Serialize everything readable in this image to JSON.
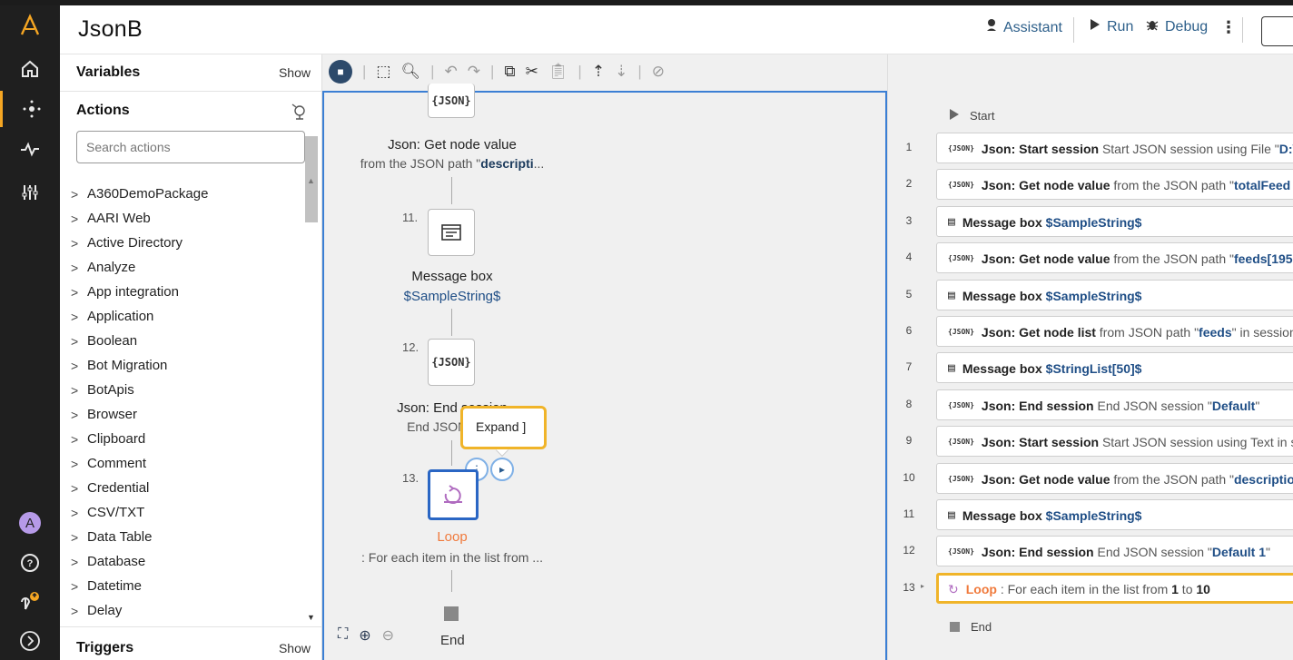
{
  "header": {
    "title": "JsonB",
    "assistant_label": "Assistant",
    "run_label": "Run",
    "debug_label": "Debug"
  },
  "rail": {
    "icons": [
      "logo-icon",
      "home-icon",
      "bots-icon",
      "activity-icon",
      "settings-icon",
      "avatar",
      "help-icon",
      "location-icon",
      "expand-icon"
    ],
    "avatar_letter": "A"
  },
  "left_panel": {
    "variables_label": "Variables",
    "variables_show": "Show",
    "actions_label": "Actions",
    "search_placeholder": "Search actions",
    "actions": [
      "A360DemoPackage",
      "AARI Web",
      "Active Directory",
      "Analyze",
      "App integration",
      "Application",
      "Boolean",
      "Bot Migration",
      "BotApis",
      "Browser",
      "Clipboard",
      "Comment",
      "Credential",
      "CSV/TXT",
      "Data Table",
      "Database",
      "Datetime",
      "Delay"
    ],
    "triggers_label": "Triggers",
    "triggers_show": "Show"
  },
  "flow": {
    "node10": {
      "icon_text": "{JSON}",
      "title": "Json: Get node value",
      "sub_prefix": "from the JSON path \"",
      "sub_value": "descripti",
      "sub_suffix": "..."
    },
    "node11": {
      "num": "11.",
      "title": "Message box",
      "sub": "$SampleString$"
    },
    "node12": {
      "num": "12.",
      "icon_text": "{JSON}",
      "title": "Json: End session",
      "sub": "End JSON sessi"
    },
    "tooltip": "Expand ]",
    "node13": {
      "num": "13.",
      "title": "Loop",
      "sub": ": For each item in the list from ..."
    },
    "end_label": "End"
  },
  "list": {
    "start_label": "Start",
    "rows": [
      {
        "n": "1",
        "icon": "json",
        "name": "Json: Start session",
        "text": " Start JSON session using File \"",
        "val": "D:\\A"
      },
      {
        "n": "2",
        "icon": "json",
        "name": "Json: Get node value",
        "text": " from the JSON path \"",
        "val": "totalFeed"
      },
      {
        "n": "3",
        "icon": "msg",
        "name": "Message box",
        "text": " ",
        "val": "$SampleString$"
      },
      {
        "n": "4",
        "icon": "json",
        "name": "Json: Get node value",
        "text": " from the JSON path \"",
        "val": "feeds[195"
      },
      {
        "n": "5",
        "icon": "msg",
        "name": "Message box",
        "text": " ",
        "val": "$SampleString$"
      },
      {
        "n": "6",
        "icon": "json",
        "name": "Json: Get node list",
        "text": " from JSON path \"",
        "val": "feeds",
        "tail": "\" in session"
      },
      {
        "n": "7",
        "icon": "msg",
        "name": "Message box",
        "text": " ",
        "val": "$StringList[50]$"
      },
      {
        "n": "8",
        "icon": "json",
        "name": "Json: End session",
        "text": " End JSON session \"",
        "val": "Default",
        "tail": "\""
      },
      {
        "n": "9",
        "icon": "json",
        "name": "Json: Start session",
        "text": " Start JSON session using Text in se",
        "val": ""
      },
      {
        "n": "10",
        "icon": "json",
        "name": "Json: Get node value",
        "text": " from the JSON path \"",
        "val": "descriptio"
      },
      {
        "n": "11",
        "icon": "msg",
        "name": "Message box",
        "text": " ",
        "val": "$SampleString$"
      },
      {
        "n": "12",
        "icon": "json",
        "name": "Json: End session",
        "text": " End JSON session \"",
        "val": "Default 1",
        "tail": "\""
      }
    ],
    "loop_row": {
      "n": "13",
      "name": "Loop",
      "text": " : For each item in the list from ",
      "v1": "1",
      "mid": " to ",
      "v2": "10"
    },
    "end_label": "End"
  }
}
